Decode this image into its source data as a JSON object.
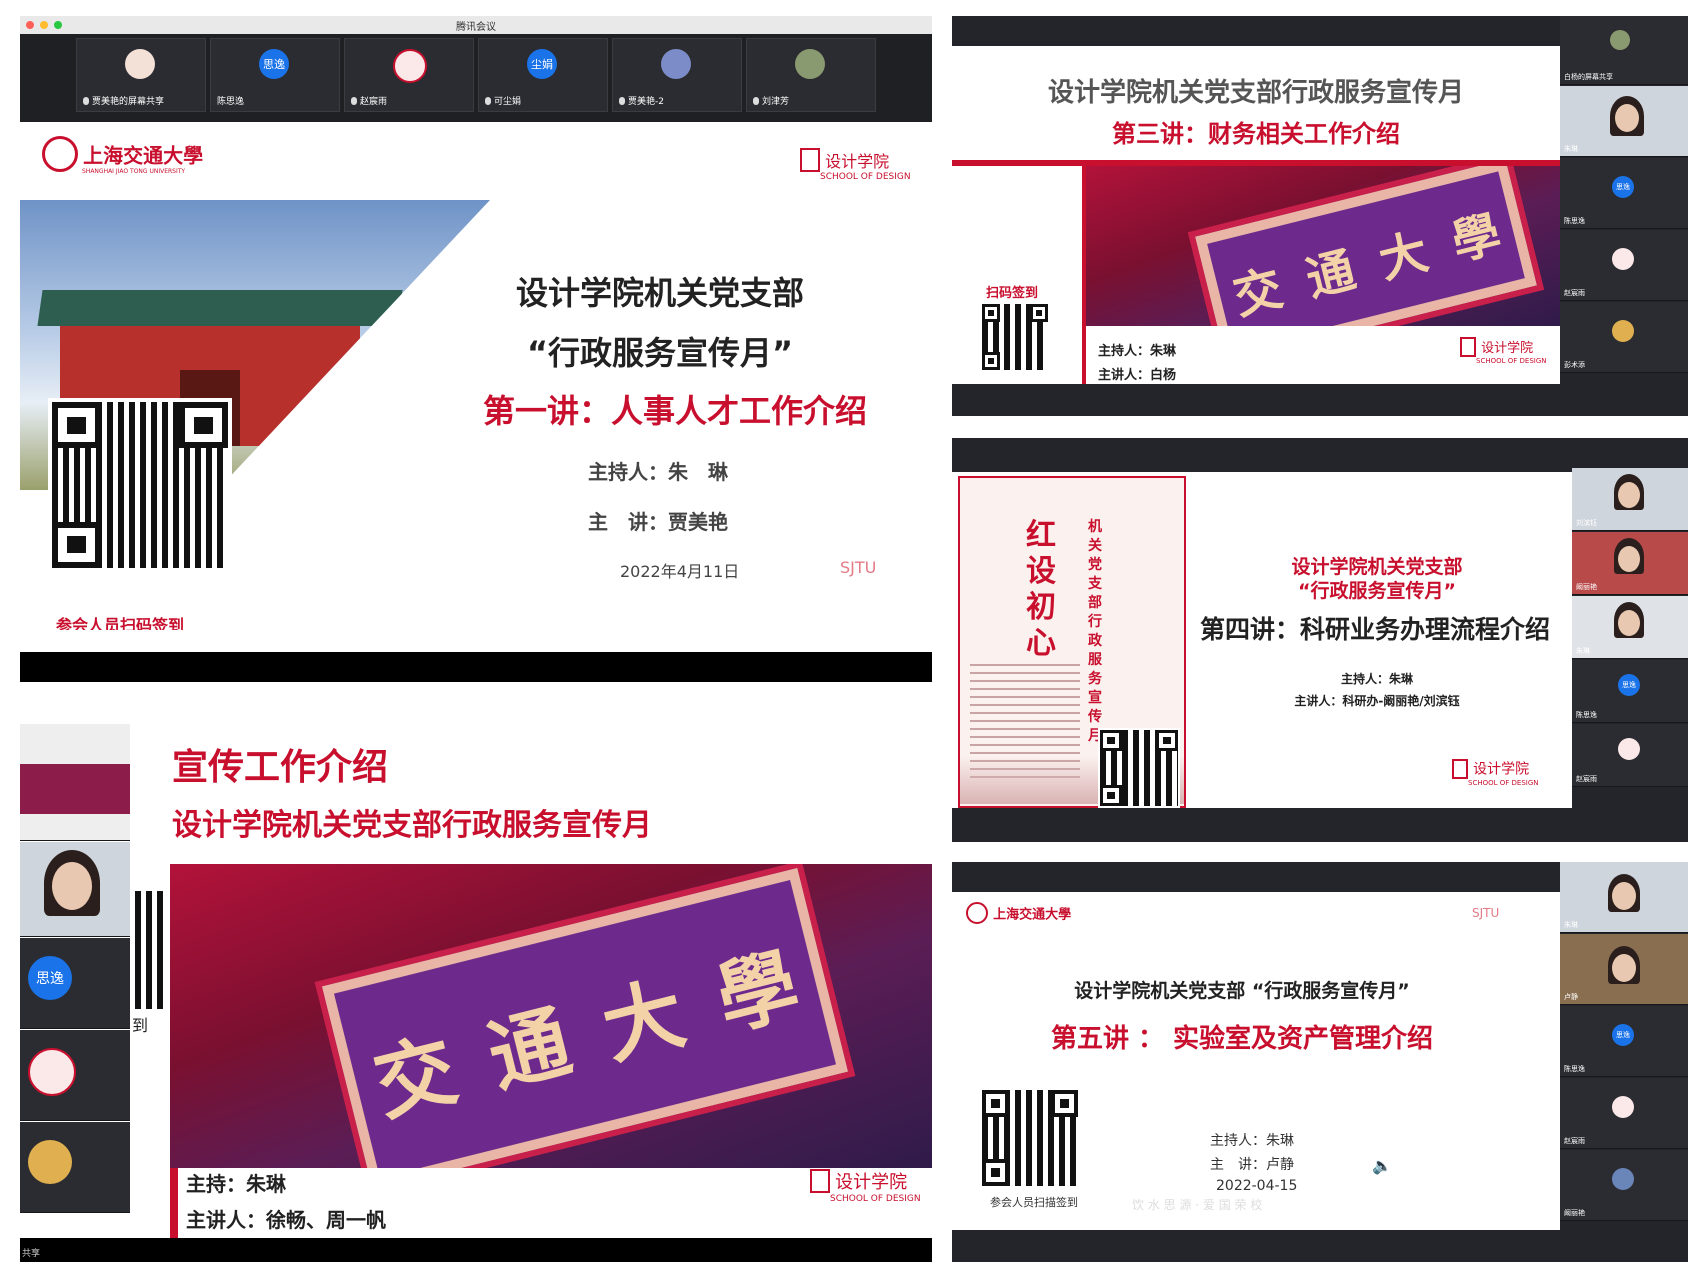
{
  "panel1": {
    "window_title": "腾讯会议",
    "participants": [
      {
        "name": "贾美艳的屏幕共享",
        "avatar": ""
      },
      {
        "name": "陈思逸",
        "avatar": "思逸"
      },
      {
        "name": "赵宸雨",
        "avatar": ""
      },
      {
        "name": "可尘娟",
        "avatar": "尘娟"
      },
      {
        "name": "贾美艳-2",
        "avatar": ""
      },
      {
        "name": "刘津芳",
        "avatar": ""
      }
    ],
    "university": "上海交通大學",
    "university_en": "SHANGHAI JIAO TONG UNIVERSITY",
    "school_cn": "设计学院",
    "school_en": "SCHOOL OF DESIGN",
    "title_line1": "设计学院机关党支部",
    "title_line2": "“行政服务宣传月”",
    "lecture": "第一讲：人事人才工作介绍",
    "host": "主持人：朱　琳",
    "speaker": "主　讲：贾美艳",
    "date": "2022年4月11日",
    "checkin": "参会人员扫码签到",
    "sjtu_mark": "SJTU"
  },
  "panel2": {
    "title": "设计学院机关党支部行政服务宣传月",
    "lecture": "第三讲：财务相关工作介绍",
    "qr_label": "扫码签到",
    "host": "主持人：朱琳",
    "speaker": "主讲人：白杨",
    "school_cn": "设计学院",
    "school_en": "SCHOOL OF DESIGN",
    "plaque_chars": [
      "交",
      "通",
      "大",
      "學"
    ],
    "side": [
      {
        "name": "白杨的屏幕共享"
      },
      {
        "name": "朱琳"
      },
      {
        "name": "陈思逸",
        "avatar": "思逸"
      },
      {
        "name": "赵宸雨"
      },
      {
        "name": "彭术添"
      }
    ]
  },
  "panel3": {
    "title": "宣传工作介绍",
    "subtitle": "设计学院机关党支部行政服务宣传月",
    "host": "主持：朱琳",
    "speaker": "主讲人：徐畅、周一帆",
    "school_cn": "设计学院",
    "school_en": "SCHOOL OF DESIGN",
    "plaque_chars": [
      "交",
      "通",
      "大",
      "學"
    ],
    "side_avatar": "思逸",
    "qr_caption": "到",
    "footer": "共享"
  },
  "panel4": {
    "poster_title": "红设初心",
    "poster_sub": "机关党支部行政服务宣传月",
    "title_line1": "设计学院机关党支部",
    "title_line2": "“行政服务宣传月”",
    "lecture": "第四讲：科研业务办理流程介绍",
    "host": "主持人：朱琳",
    "speaker": "主讲人：科研办-阚丽艳/刘滨钰",
    "school_cn": "设计学院",
    "school_en": "SCHOOL OF DESIGN",
    "side": [
      {
        "name": "刘滨钰"
      },
      {
        "name": "阚丽艳"
      },
      {
        "name": "朱琳"
      },
      {
        "name": "陈思逸",
        "avatar": "思逸"
      },
      {
        "name": "赵宸雨"
      }
    ]
  },
  "panel5": {
    "university": "上海交通大學",
    "title": "设计学院机关党支部 “行政服务宣传月”",
    "lecture": "第五讲 ： 实验室及资产管理介绍",
    "host": "主持人：朱琳",
    "speaker": "主　讲：卢静",
    "date": "2022-04-15",
    "checkin": "参会人员扫描签到",
    "motto": "饮 水 思 源 · 爱 国 荣 校",
    "sjtu_mark": "SJTU",
    "side": [
      {
        "name": "朱琳"
      },
      {
        "name": "卢静"
      },
      {
        "name": "陈思逸",
        "avatar": "思逸"
      },
      {
        "name": "赵宸雨"
      },
      {
        "name": "阚丽艳"
      }
    ]
  },
  "colors": {
    "accent_red": "#c8102e",
    "meeting_dark": "#1f2024",
    "avatar_blue": "#1a73e8"
  }
}
